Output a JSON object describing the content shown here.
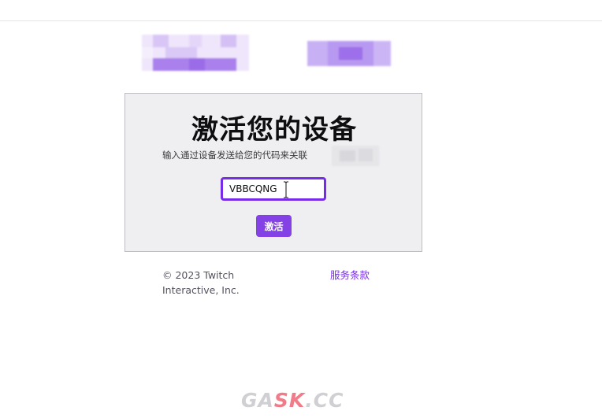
{
  "header": {},
  "card": {
    "title": "激活您的设备",
    "subtitle": "输入通过设备发送给您的代码来关联",
    "code_input_value": "VBBCQNG",
    "activate_label": "激活"
  },
  "footer": {
    "copyright_line1": "© 2023 Twitch",
    "copyright_line2": "Interactive, Inc.",
    "terms_label": "服务条款"
  },
  "watermark": {
    "text_part1": "GA",
    "text_part2": "SK",
    "text_part3": ".CC"
  },
  "colors": {
    "accent": "#772ce8",
    "button": "#8441e6",
    "card_bg": "#efeff1"
  }
}
